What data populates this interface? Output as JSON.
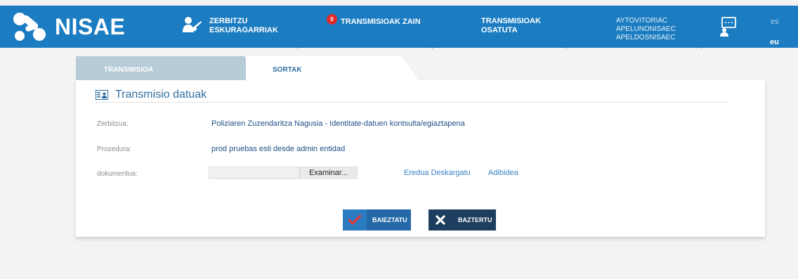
{
  "brand": {
    "name": "NISAE"
  },
  "nav": {
    "services": "ZERBITZU ESKURAGARRIAK",
    "pending": "TRANSMISIOAK ZAIN",
    "pending_count": "0",
    "done": "TRANSMISIOAK OSATUTA",
    "user_lines": [
      "AYTOVITORIAC",
      "APELUNONISAEC",
      "APELDOSNISAEC"
    ],
    "lang_es": "es",
    "lang_eu": "eu"
  },
  "tabs": {
    "transmisioa": "TRANSMISIOA",
    "sortak": "SORTAK"
  },
  "card": {
    "title": "Transmisio datuak",
    "service_label": "Zerbitzua:",
    "service_value": "Poliziaren Zuzendaritza Nagusia - Identitate-datuen kontsulta/egiaztapena",
    "procedure_label": "Prozedura:",
    "procedure_value": "prod pruebas esti desde admin entidad",
    "document_label": "dokumentua:",
    "browse_label": "Examinar...",
    "download_link": "Eredua Deskargatu",
    "example_link": "Adibidea",
    "confirm_label": "BAIEZTATU",
    "reject_label": "BAZTERTU"
  },
  "colors": {
    "header": "#1b7cc1",
    "badge": "#e32a2a",
    "confirm": "#2468a8",
    "reject": "#1d3e5e"
  },
  "icons": [
    "logo-icon",
    "services-icon",
    "chat-icon",
    "card-icon",
    "check-icon",
    "x-icon"
  ]
}
